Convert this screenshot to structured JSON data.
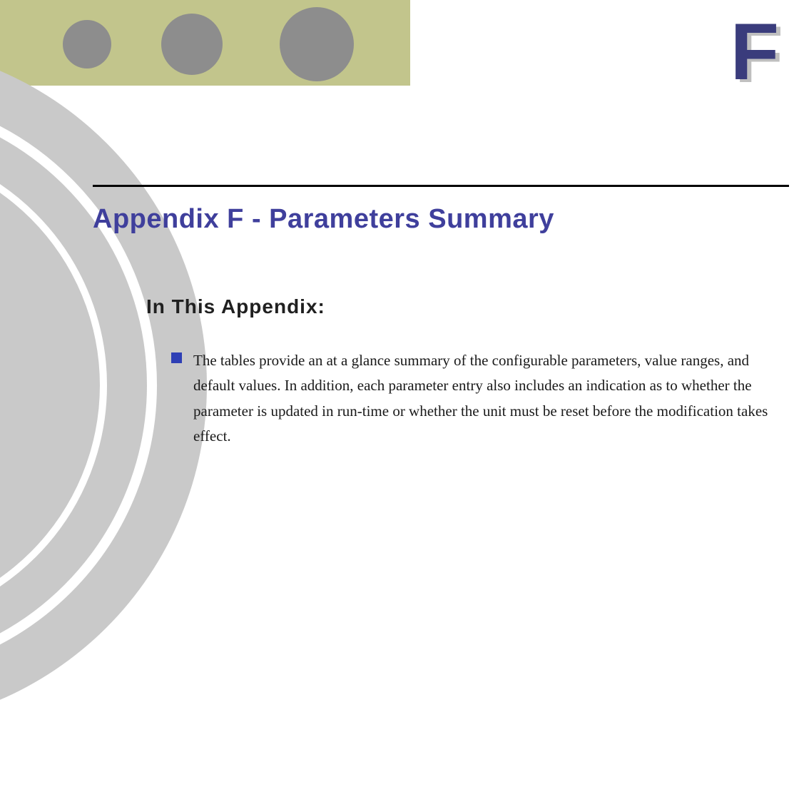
{
  "chapter_letter": "F",
  "title": "Appendix F - Parameters Summary",
  "subhead": "In This Appendix:",
  "bullet": "The tables provide an at a glance summary of the configurable parameters, value ranges, and default values. In addition, each parameter entry also includes an indication as to whether the parameter is updated in run-time or whether the unit must be reset before the modification takes effect."
}
